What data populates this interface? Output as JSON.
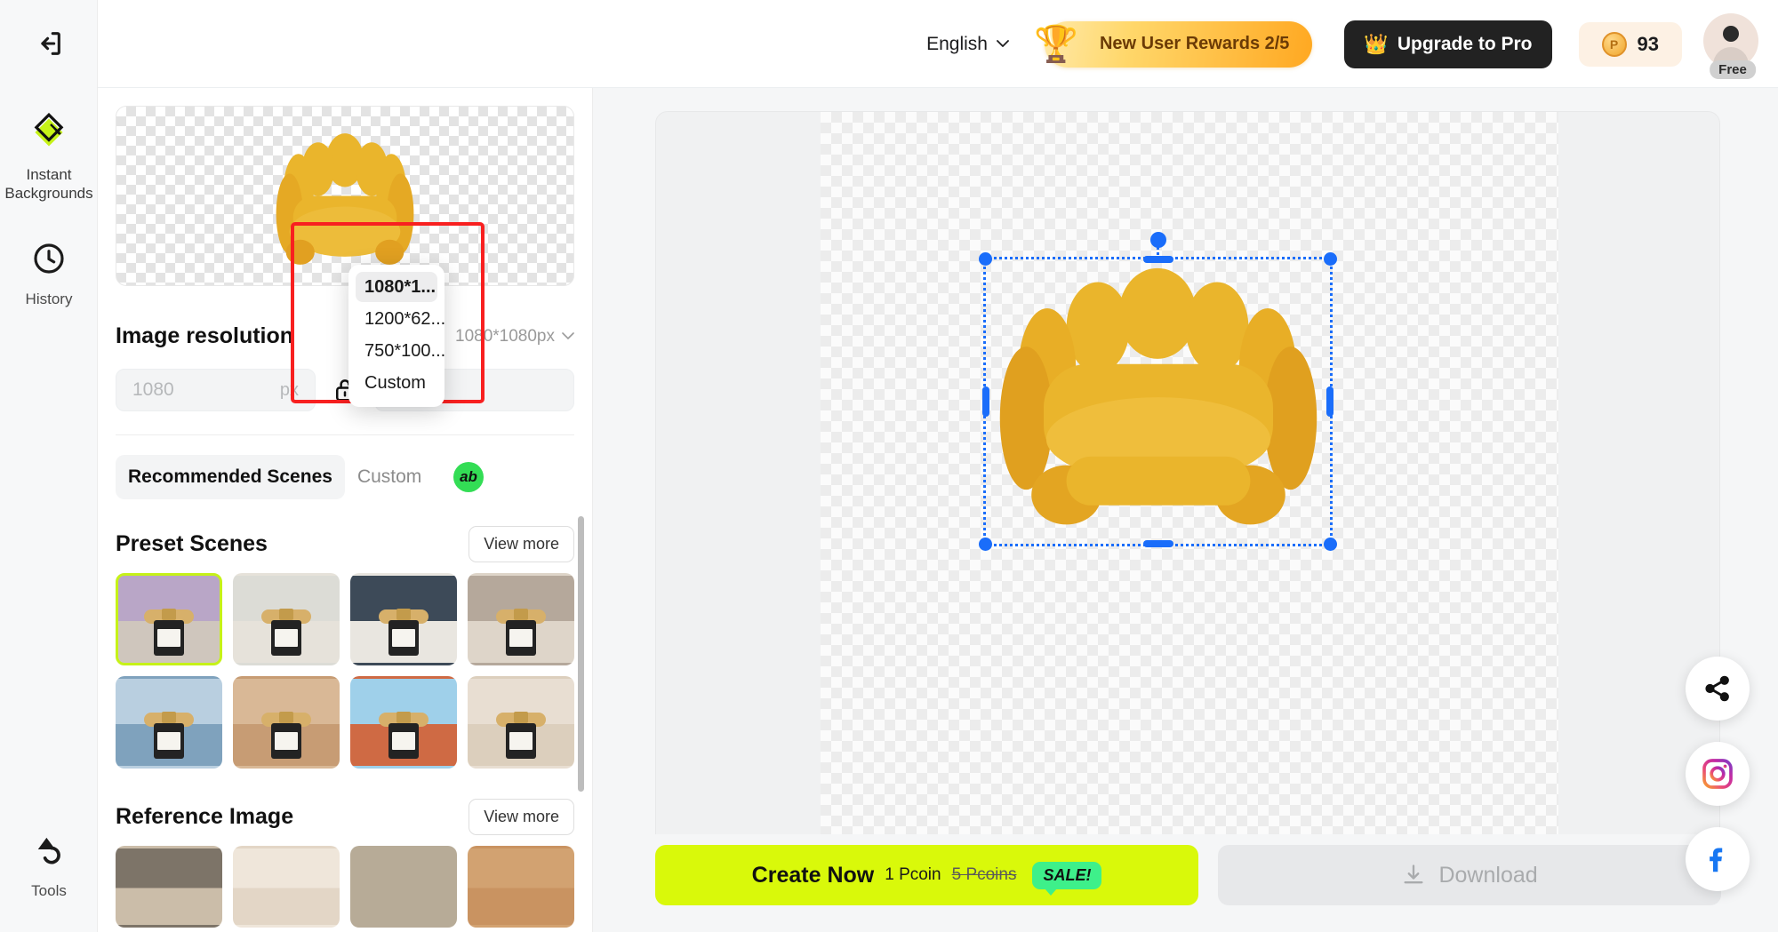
{
  "header": {
    "collapse_icon": "collapse-sidebar-icon",
    "language": "English",
    "chevron_icon": "chevron-down-icon",
    "rewards_label": "New User Rewards 2/5",
    "rewards_icon": "trophy-icon",
    "upgrade_label": "Upgrade to Pro",
    "upgrade_icon": "crown-icon",
    "coin_icon": "pcoin-icon",
    "coin_balance": "93",
    "avatar_icon": "avatar",
    "plan_badge": "Free"
  },
  "rail": {
    "items": [
      {
        "label": "Instant Backgrounds",
        "icon": "instant-backgrounds-icon",
        "active": true
      },
      {
        "label": "History",
        "icon": "clock-icon",
        "active": false
      }
    ],
    "bottom": {
      "label": "Tools",
      "icon": "tools-icon"
    }
  },
  "panel": {
    "preview_alt": "yellow-armchair-cutout",
    "resolution": {
      "title": "Image resolution",
      "selected": "1080*1080px",
      "chevron_icon": "chevron-down-icon",
      "width_value": "1080",
      "width_unit": "px",
      "height_value": "1080",
      "lock_icon": "unlock-icon",
      "options": [
        {
          "label": "1080*1...",
          "selected": true
        },
        {
          "label": "1200*62...",
          "selected": false
        },
        {
          "label": "750*100...",
          "selected": false
        },
        {
          "label": "Custom",
          "selected": false
        }
      ]
    },
    "tabs": [
      {
        "label": "Recommended Scenes",
        "active": true
      },
      {
        "label": "Custom",
        "active": false
      }
    ],
    "ab_badge": "ab",
    "preset_scenes": {
      "title": "Preset Scenes",
      "view_more": "View more",
      "thumbs": [
        {
          "name": "scene-road-sunset",
          "selected": true,
          "sky": "#b9a6c7",
          "ground": "#cfc6bd"
        },
        {
          "name": "scene-bright-interior",
          "selected": false,
          "sky": "#dcdcd6",
          "ground": "#e6e2da"
        },
        {
          "name": "scene-blue-wall-shadow",
          "selected": false,
          "sky": "#3d4a58",
          "ground": "#e9e6e0"
        },
        {
          "name": "scene-stone-wall",
          "selected": false,
          "sky": "#b5a89b",
          "ground": "#ded5c9"
        },
        {
          "name": "scene-water-sky",
          "selected": false,
          "sky": "#b9cfe0",
          "ground": "#7fa2bd"
        },
        {
          "name": "scene-warm-room",
          "selected": false,
          "sky": "#d9b896",
          "ground": "#c79c74"
        },
        {
          "name": "scene-sky-terracotta",
          "selected": false,
          "sky": "#9fd0ea",
          "ground": "#cf6a44"
        },
        {
          "name": "scene-curtain-window",
          "selected": false,
          "sky": "#e8ded2",
          "ground": "#dccfbd"
        }
      ]
    },
    "reference_image": {
      "title": "Reference Image",
      "view_more": "View more",
      "thumbs": [
        {
          "name": "ref-cutting-board",
          "sky": "#7d7468",
          "ground": "#cbbda9"
        },
        {
          "name": "ref-light-shadow",
          "sky": "#efe6da",
          "ground": "#e3d6c6"
        },
        {
          "name": "ref-pink-flower",
          "sky": "#b7ab97",
          "ground": "#b7ab97"
        },
        {
          "name": "ref-dried-flower",
          "sky": "#d2a271",
          "ground": "#c99361"
        }
      ]
    },
    "scrollbar": "panel-scrollbar"
  },
  "canvas": {
    "image_alt": "yellow-armchair",
    "selection": "image-selection-box",
    "handles": [
      "rotate-handle",
      "top-left-handle",
      "top-center-handle",
      "top-right-handle",
      "middle-left-handle",
      "middle-right-handle",
      "bottom-left-handle",
      "bottom-center-handle",
      "bottom-right-handle"
    ]
  },
  "social": [
    {
      "name": "share-icon",
      "label": "Share"
    },
    {
      "name": "instagram-icon",
      "label": "Instagram"
    },
    {
      "name": "facebook-icon",
      "label": "Facebook"
    }
  ],
  "footer": {
    "create_label": "Create Now",
    "create_price": "1 Pcoin",
    "create_old_price": "5 Pcoins",
    "sale_label": "SALE!",
    "download_label": "Download",
    "download_icon": "download-icon"
  },
  "colors": {
    "accent_lime": "#d9f90a",
    "selection_blue": "#1a6dfa",
    "highlight_red": "#f82020",
    "sale_green": "#3ef08a",
    "dark": "#222222"
  }
}
